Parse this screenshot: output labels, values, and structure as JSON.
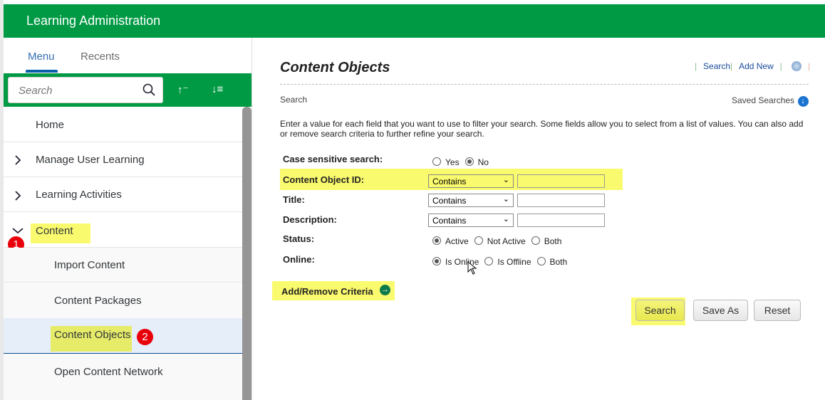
{
  "header": {
    "title": "Learning Administration"
  },
  "sidebar": {
    "tabs": [
      {
        "label": "Menu",
        "active": true
      },
      {
        "label": "Recents",
        "active": false
      }
    ],
    "search_placeholder": "Search",
    "sort_up_label": "↑⁻",
    "sort_down_label": "↓≡",
    "items": [
      {
        "label": "Home"
      },
      {
        "label": "Manage User Learning",
        "icon": "chevron-right-icon"
      },
      {
        "label": "Learning Activities",
        "icon": "chevron-right-icon"
      },
      {
        "label": "Content",
        "icon": "chevron-down-icon",
        "expanded": true
      },
      {
        "label": "Import Content"
      },
      {
        "label": "Content Packages"
      },
      {
        "label": "Content Objects",
        "selected": true
      },
      {
        "label": "Open Content Network"
      }
    ],
    "badges": [
      "1",
      "2"
    ]
  },
  "main": {
    "title": "Content Objects",
    "links": [
      "Search",
      "Add New"
    ],
    "section": "Search",
    "saved_searches": "Saved Searches",
    "instructions": "Enter a value for each field that you want to use to filter your search. Some fields allow you to select from a list of values. You can also add or remove search criteria to further refine your search.",
    "fields": {
      "case": {
        "label": "Case sensitive search:",
        "options": [
          "Yes",
          "No"
        ],
        "selected": "No"
      },
      "id": {
        "label": "Content Object ID:",
        "operator": "Contains",
        "value": ""
      },
      "title": {
        "label": "Title:",
        "operator": "Contains",
        "value": ""
      },
      "description": {
        "label": "Description:",
        "operator": "Contains",
        "value": ""
      },
      "status": {
        "label": "Status:",
        "options": [
          "Active",
          "Not Active",
          "Both"
        ],
        "selected": "Active"
      },
      "online": {
        "label": "Online:",
        "options": [
          "Is Online",
          "Is Offline",
          "Both"
        ],
        "selected": "Is Online"
      }
    },
    "add_remove": "Add/Remove Criteria",
    "buttons": {
      "search": "Search",
      "save_as": "Save As",
      "reset": "Reset"
    }
  },
  "colors": {
    "brand": "#009a44",
    "highlight": "#fafa6e",
    "badge": "#e8000b",
    "link": "#1a4c9a"
  }
}
